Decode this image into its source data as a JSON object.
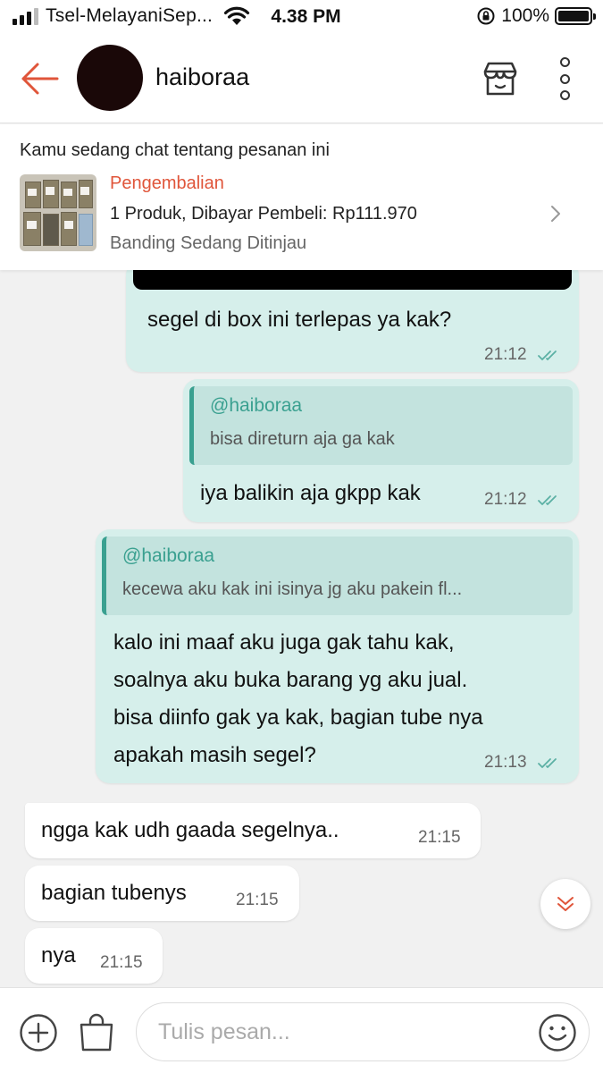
{
  "status_bar": {
    "carrier": "Tsel-MelayaniSep...",
    "time": "4.38 PM",
    "battery": "100%"
  },
  "header": {
    "contact_name": "haiboraa",
    "accent_color": "#e0553a"
  },
  "order_card": {
    "intro": "Kamu sedang chat tentang pesanan ini",
    "status": "Pengembalian",
    "detail": "1 Produk, Dibayar Pembeli: Rp111.970",
    "sub_status": "Banding Sedang Ditinjau"
  },
  "messages": [
    {
      "direction": "out",
      "lines": [
        "segel di box ini terlepas ya kak?"
      ],
      "time": "21:12",
      "read": true
    },
    {
      "direction": "out",
      "quote": {
        "name": "@haiboraa",
        "text": "bisa direturn aja ga kak"
      },
      "lines": [
        "iya balikin aja gkpp kak"
      ],
      "time": "21:12",
      "read": true
    },
    {
      "direction": "out",
      "quote": {
        "name": "@haiboraa",
        "text": "kecewa aku kak ini isinya jg aku pakein fl..."
      },
      "lines": [
        "kalo ini maaf aku juga gak tahu kak,",
        "soalnya aku buka barang yg aku jual.",
        "bisa diinfo gak ya kak, bagian tube nya",
        "apakah masih segel?"
      ],
      "time": "21:13",
      "read": true
    },
    {
      "direction": "in",
      "lines": [
        "ngga kak udh gaada segelnya.."
      ],
      "time": "21:15"
    },
    {
      "direction": "in",
      "lines": [
        "bagian tubenys"
      ],
      "time": "21:15"
    },
    {
      "direction": "in",
      "lines": [
        "nya"
      ],
      "time": "21:15"
    }
  ],
  "input": {
    "placeholder": "Tulis pesan..."
  }
}
